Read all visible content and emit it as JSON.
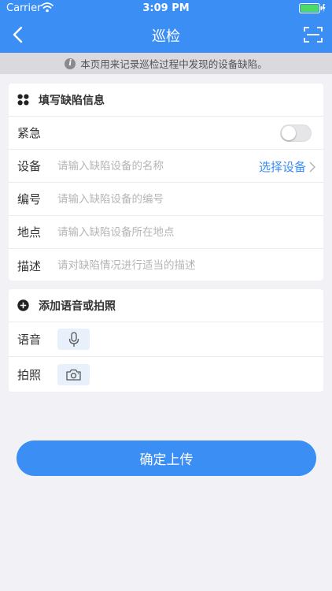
{
  "status_bar": {
    "carrier": "Carrier",
    "time": "3:09 PM"
  },
  "nav": {
    "title": "巡检"
  },
  "notice": {
    "text": "本页用来记录巡检过程中发现的设备缺陷。"
  },
  "defect_section": {
    "title": "填写缺陷信息",
    "urgent": {
      "label": "紧急",
      "on": false
    },
    "device": {
      "label": "设备",
      "placeholder": "请输入缺陷设备的名称",
      "action": "选择设备"
    },
    "code": {
      "label": "编号",
      "placeholder": "请输入缺陷设备的编号"
    },
    "location": {
      "label": "地点",
      "placeholder": "请输入缺陷设备所在地点"
    },
    "description": {
      "label": "描述",
      "placeholder": "请对缺陷情况进行适当的描述"
    }
  },
  "media_section": {
    "title": "添加语音或拍照",
    "voice": {
      "label": "语音"
    },
    "photo": {
      "label": "拍照"
    }
  },
  "submit": {
    "label": "确定上传"
  },
  "colors": {
    "primary": "#3a8ef4",
    "background": "#f2f2f6",
    "notice_bg": "#d9d9de"
  },
  "icons": [
    "back-icon",
    "scan-icon",
    "info-icon",
    "grid-icon",
    "plus-circle-icon",
    "chevron-right-icon",
    "microphone-icon",
    "camera-icon",
    "wifi-icon",
    "battery-icon"
  ]
}
